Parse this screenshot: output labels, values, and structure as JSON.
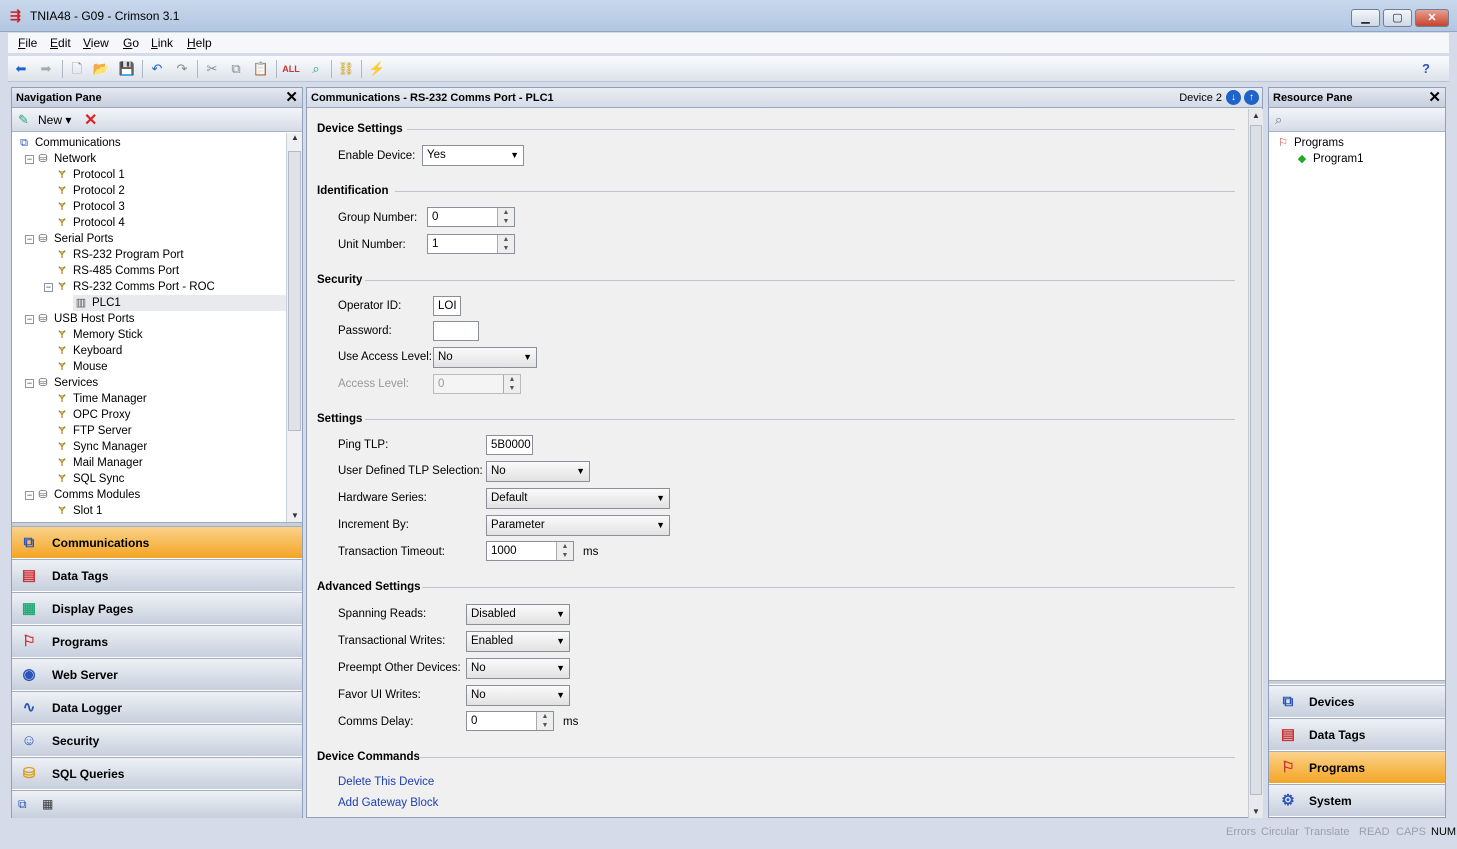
{
  "window": {
    "title": "TNIA48 - G09 - Crimson 3.1",
    "min": "▁",
    "max": "▢",
    "close": "✕"
  },
  "menu": [
    "File",
    "Edit",
    "View",
    "Go",
    "Link",
    "Help"
  ],
  "toolbar_icons": [
    "back-icon",
    "forward-icon",
    "new-file-icon",
    "open-folder-icon",
    "save-icon",
    "undo-icon",
    "redo-icon",
    "cut-icon",
    "copy-icon",
    "paste-icon",
    "spell-check-icon",
    "find-icon",
    "link-icon",
    "wand-icon"
  ],
  "nav": {
    "title": "Navigation Pane",
    "close": "✕",
    "new_label": "New",
    "delete": "✕",
    "tree": [
      {
        "label": "Communications",
        "level": 0
      },
      {
        "label": "Network",
        "level": 1,
        "exp": "−"
      },
      {
        "label": "Protocol 1",
        "level": 2
      },
      {
        "label": "Protocol 2",
        "level": 2
      },
      {
        "label": "Protocol 3",
        "level": 2
      },
      {
        "label": "Protocol 4",
        "level": 2
      },
      {
        "label": "Serial Ports",
        "level": 1,
        "exp": "−"
      },
      {
        "label": "RS-232 Program Port",
        "level": 2
      },
      {
        "label": "RS-485 Comms Port",
        "level": 2
      },
      {
        "label": "RS-232 Comms Port - ROC",
        "level": 2,
        "exp": "−"
      },
      {
        "label": "PLC1",
        "level": 3,
        "selected": true
      },
      {
        "label": "USB Host Ports",
        "level": 1,
        "exp": "−"
      },
      {
        "label": "Memory Stick",
        "level": 2
      },
      {
        "label": "Keyboard",
        "level": 2
      },
      {
        "label": "Mouse",
        "level": 2
      },
      {
        "label": "Services",
        "level": 1,
        "exp": "−"
      },
      {
        "label": "Time Manager",
        "level": 2
      },
      {
        "label": "OPC Proxy",
        "level": 2
      },
      {
        "label": "FTP Server",
        "level": 2
      },
      {
        "label": "Sync Manager",
        "level": 2
      },
      {
        "label": "Mail Manager",
        "level": 2
      },
      {
        "label": "SQL Sync",
        "level": 2
      },
      {
        "label": "Comms Modules",
        "level": 1,
        "exp": "−"
      },
      {
        "label": "Slot 1",
        "level": 2
      }
    ],
    "categories": [
      {
        "label": "Communications",
        "active": true
      },
      {
        "label": "Data Tags"
      },
      {
        "label": "Display Pages"
      },
      {
        "label": "Programs"
      },
      {
        "label": "Web Server"
      },
      {
        "label": "Data Logger"
      },
      {
        "label": "Security"
      },
      {
        "label": "SQL Queries"
      }
    ]
  },
  "main": {
    "title": "Communications - RS-232 Comms Port - PLC1",
    "device": "Device 2",
    "sections": {
      "device": "Device Settings",
      "ident": "Identification",
      "security": "Security",
      "settings": "Settings",
      "advanced": "Advanced Settings",
      "commands": "Device Commands"
    },
    "fields": {
      "enable_device": {
        "label": "Enable Device:",
        "value": "Yes"
      },
      "group_number": {
        "label": "Group Number:",
        "value": "0"
      },
      "unit_number": {
        "label": "Unit Number:",
        "value": "1"
      },
      "operator_id": {
        "label": "Operator ID:",
        "value": "LOI"
      },
      "password": {
        "label": "Password:",
        "value": ""
      },
      "use_access_level": {
        "label": "Use Access Level:",
        "value": "No"
      },
      "access_level": {
        "label": "Access Level:",
        "value": "0"
      },
      "ping_tlp": {
        "label": "Ping TLP:",
        "value": "5B0000"
      },
      "user_tlp": {
        "label": "User Defined TLP Selection:",
        "value": "No"
      },
      "hardware_series": {
        "label": "Hardware Series:",
        "value": "Default"
      },
      "increment_by": {
        "label": "Increment By:",
        "value": "Parameter"
      },
      "transaction_timeout": {
        "label": "Transaction Timeout:",
        "value": "1000",
        "unit": "ms"
      },
      "spanning_reads": {
        "label": "Spanning Reads:",
        "value": "Disabled"
      },
      "transactional_writes": {
        "label": "Transactional Writes:",
        "value": "Enabled"
      },
      "preempt": {
        "label": "Preempt Other Devices:",
        "value": "No"
      },
      "favor_ui": {
        "label": "Favor UI Writes:",
        "value": "No"
      },
      "comms_delay": {
        "label": "Comms Delay:",
        "value": "0",
        "unit": "ms"
      }
    },
    "commands": [
      "Delete This Device",
      "Add Gateway Block"
    ]
  },
  "resource": {
    "title": "Resource Pane",
    "close": "✕",
    "tree": [
      {
        "label": "Programs",
        "level": 0
      },
      {
        "label": "Program1",
        "level": 1
      }
    ],
    "categories": [
      {
        "label": "Devices"
      },
      {
        "label": "Data Tags"
      },
      {
        "label": "Programs",
        "active": true
      },
      {
        "label": "System"
      }
    ]
  },
  "status": [
    {
      "label": "Errors",
      "on": false
    },
    {
      "label": "Circular",
      "on": false
    },
    {
      "label": "Translate",
      "on": false
    },
    {
      "label": "READ",
      "on": false
    },
    {
      "label": "CAPS",
      "on": false
    },
    {
      "label": "NUM",
      "on": true
    }
  ],
  "colors": {
    "active": "#f3a524",
    "link": "#1a3fb3"
  }
}
